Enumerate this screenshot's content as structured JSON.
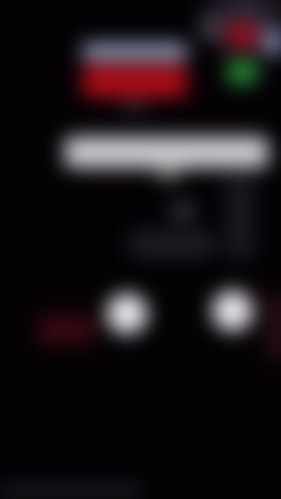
{
  "screen": {
    "state": "blurred",
    "background_color": "#050206"
  },
  "logo": {
    "colors": {
      "top": "#9aa2c0",
      "middle": "#b00d18"
    }
  },
  "decor": {
    "corner_colors": [
      "#8a1020",
      "#6f7797",
      "#2b8e3a",
      "#4d4a57"
    ]
  },
  "controls": {
    "dot_color": "#e9e7ec"
  }
}
